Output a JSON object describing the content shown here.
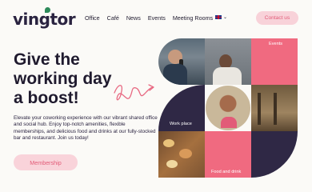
{
  "brand": {
    "logo_text": "vingtor"
  },
  "nav": {
    "items": [
      "Office",
      "Café",
      "News",
      "Events",
      "Meeting Rooms"
    ],
    "language_chevron": "⌄",
    "contact_label": "Contact us"
  },
  "hero": {
    "title_lines": [
      "Give the",
      "working day",
      "a boost!"
    ],
    "description": "Elevate your coworking experience with our vibrant shared office and social hub. Enjoy top-notch amenities, flexible memberships, and delicious food and drinks at our fully-stocked bar and restaurant. Join us today!",
    "cta_label": "Membership"
  },
  "tiles": {
    "events_label": "Events",
    "workplace_label": "Work place",
    "food_label": "Food and drink"
  },
  "colors": {
    "accent": "#e25b78",
    "pink_tile": "#f06a80",
    "dark_tile": "#2f2845",
    "button_bg": "#f9d3da"
  }
}
